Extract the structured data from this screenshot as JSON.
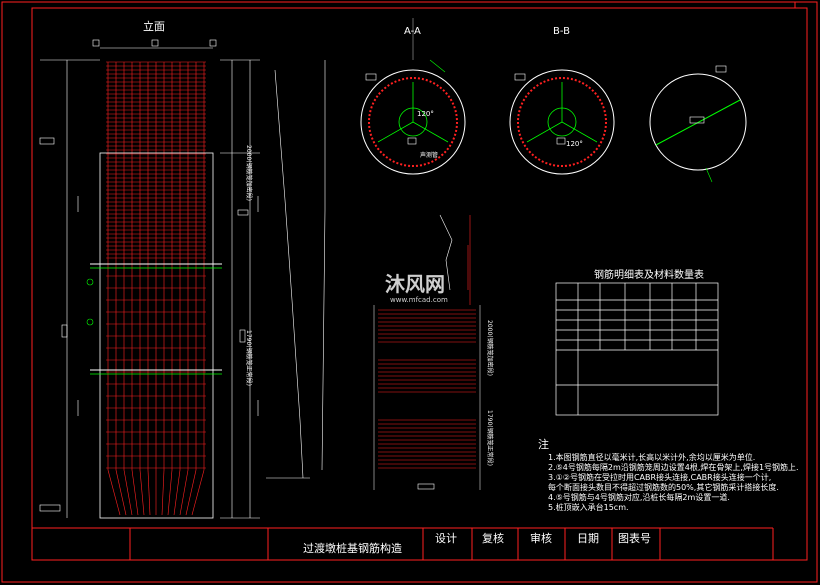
{
  "drawing": {
    "elevation_label": "立面",
    "section_aa": "A-A",
    "section_bb": "B-B",
    "title": "过渡墩桩基钢筋构造",
    "title_block": [
      "设计",
      "复核",
      "审核",
      "日期",
      "图表号"
    ],
    "table_title": "钢筋明细表及材料数量表",
    "notes_heading": "注",
    "notes": [
      "1.本图钢筋直径以毫米计,长高以米计外,余均以厘米为单位.",
      "2.⑤4号钢筋每隔2m沿钢筋笼周边设置4根,焊在骨架上,焊接1号钢筋上.",
      "3.①②号钢筋在受拉时用CABR接头连接,CABR接头连接一个计,",
      "  每个断面接头数目不得超过钢筋数的50%,其它钢筋采计搭接长度.",
      "4.⑤号钢筋与4号钢筋对应,沿桩长每隔2m设置一道.",
      "5.桩顶嵌入承台15cm."
    ],
    "section_angles": [
      "120°",
      "120°"
    ],
    "section_side_label": "声测管",
    "watermark_cn": "沐风网",
    "watermark_url": "www.mfcad.com",
    "colors": {
      "rebar": "#ff2020",
      "frame": "#ff2020",
      "lines": "#ffffff",
      "accent": "#00ff00"
    }
  }
}
